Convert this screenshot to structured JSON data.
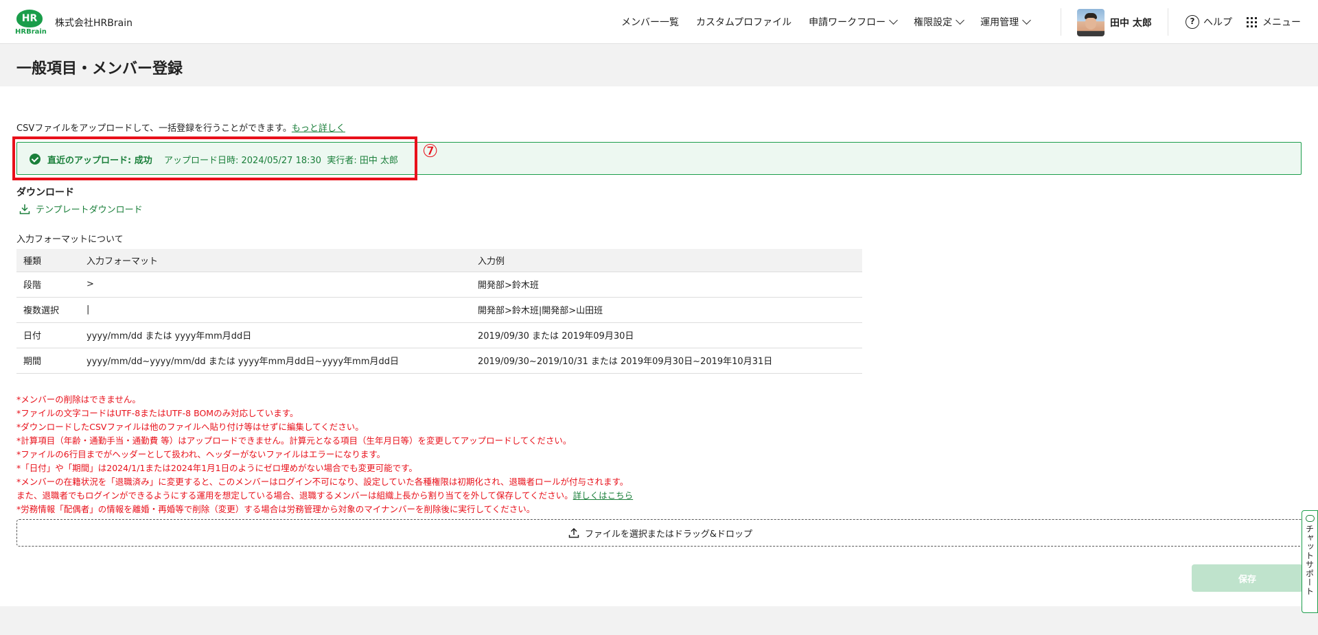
{
  "header": {
    "logo_mark": "HR",
    "logo_text": "HRBrain",
    "company": "株式会社HRBrain",
    "nav": [
      {
        "label": "メンバー一覧"
      },
      {
        "label": "カスタムプロファイル"
      },
      {
        "label": "申請ワークフロー"
      },
      {
        "label": "権限設定"
      },
      {
        "label": "運用管理"
      }
    ],
    "user_name": "田中 太郎",
    "help_label": "ヘルプ",
    "menu_label": "メニュー"
  },
  "page": {
    "title": "一般項目・メンバー登録",
    "intro": "CSVファイルをアップロードして、一括登録を行うことができます。",
    "intro_link": "もっと詳しく"
  },
  "banner": {
    "status": "直近のアップロード: 成功",
    "uploaded_at": "アップロード日時: 2024/05/27 18:30",
    "executor": "実行者: 田中 太郎",
    "marker": "⑦"
  },
  "download": {
    "label": "ダウンロード",
    "template_link": "テンプレートダウンロード"
  },
  "format": {
    "label": "入力フォーマットについて",
    "headers": [
      "種類",
      "入力フォーマット",
      "入力例"
    ],
    "rows": [
      [
        "段階",
        ">",
        "開発部>鈴木班"
      ],
      [
        "複数選択",
        "|",
        "開発部>鈴木班|開発部>山田班"
      ],
      [
        "日付",
        "yyyy/mm/dd または yyyy年mm月dd日",
        "2019/09/30 または 2019年09月30日"
      ],
      [
        "期間",
        "yyyy/mm/dd~yyyy/mm/dd または yyyy年mm月dd日~yyyy年mm月dd日",
        "2019/09/30~2019/10/31 または 2019年09月30日~2019年10月31日"
      ]
    ]
  },
  "notes": [
    "*メンバーの削除はできません。",
    "*ファイルの文字コードはUTF-8またはUTF-8 BOMのみ対応しています。",
    "*ダウンロードしたCSVファイルは他のファイルへ貼り付け等はせずに編集してください。",
    "*計算項目（年齢・通勤手当・通勤費 等）はアップロードできません。計算元となる項目（生年月日等）を変更してアップロードしてください。",
    "*ファイルの6行目までがヘッダーとして扱われ、ヘッダーがないファイルはエラーになります。",
    "*「日付」や「期間」は2024/1/1または2024年1月1日のようにゼロ埋めがない場合でも変更可能です。",
    "*メンバーの在籍状況を「退職済み」に変更すると、このメンバーはログイン不可になり、設定していた各種権限は初期化され、退職者ロールが付与されます。",
    "また、退職者でもログインができるようにする運用を想定している場合、退職するメンバーは組織上長から割り当てを外して保存してください。",
    "*労務情報「配偶者」の情報を離婚・再婚等で削除（変更）する場合は労務管理から対象のマイナンバーを削除後に実行してください。"
  ],
  "notes_link": "詳しくはこちら",
  "dropzone_label": "ファイルを選択またはドラッグ&ドロップ",
  "save_label": "保存",
  "chat_label": "チャットサポート"
}
